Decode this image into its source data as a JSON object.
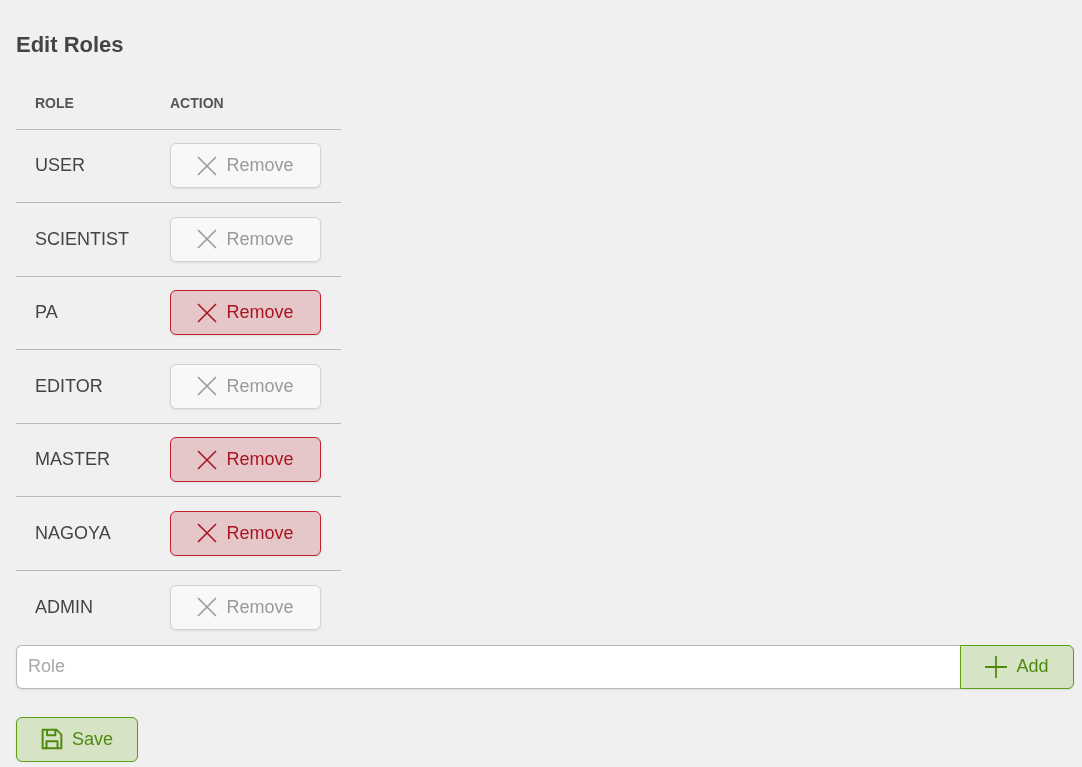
{
  "title": "Edit Roles",
  "table": {
    "columns": [
      "ROLE",
      "ACTION"
    ],
    "rows": [
      {
        "role": "USER",
        "remove": {
          "label": "Remove",
          "active": false
        }
      },
      {
        "role": "SCIENTIST",
        "remove": {
          "label": "Remove",
          "active": false
        }
      },
      {
        "role": "PA",
        "remove": {
          "label": "Remove",
          "active": true
        }
      },
      {
        "role": "EDITOR",
        "remove": {
          "label": "Remove",
          "active": false
        }
      },
      {
        "role": "MASTER",
        "remove": {
          "label": "Remove",
          "active": true
        }
      },
      {
        "role": "NAGOYA",
        "remove": {
          "label": "Remove",
          "active": true
        }
      },
      {
        "role": "ADMIN",
        "remove": {
          "label": "Remove",
          "active": false
        }
      }
    ]
  },
  "new_role": {
    "placeholder": "Role",
    "add_button": "Add"
  },
  "save_button": "Save"
}
